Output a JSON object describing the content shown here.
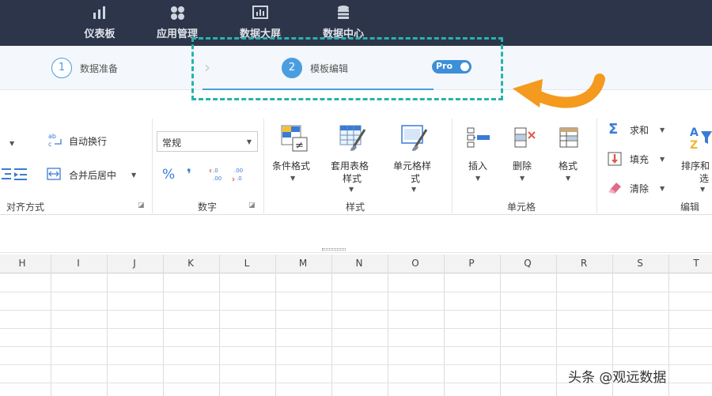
{
  "topnav": {
    "items": [
      {
        "label": "仪表板",
        "icon": "bar-chart-icon"
      },
      {
        "label": "应用管理",
        "icon": "grid-apps-icon"
      },
      {
        "label": "数据大屏",
        "icon": "screen-chart-icon"
      },
      {
        "label": "数据中心",
        "icon": "database-icon"
      }
    ]
  },
  "steps": {
    "step1": {
      "number": "1",
      "label": "数据准备"
    },
    "step2": {
      "number": "2",
      "label": "模板编辑"
    },
    "pro_label": "Pro"
  },
  "ribbon": {
    "alignment": {
      "wrap_text": "自动换行",
      "merge_center": "合并后居中",
      "group_label": "对齐方式"
    },
    "number": {
      "format_value": "常规",
      "percent_symbol": "%",
      "comma_symbol": "❜",
      "group_label": "数字"
    },
    "styles": {
      "conditional_format": "条件格式",
      "table_style_line1": "套用表格",
      "table_style_line2": "样式",
      "cell_style_line1": "单元格样",
      "cell_style_line2": "式",
      "group_label": "样式"
    },
    "cells": {
      "insert": "插入",
      "delete": "删除",
      "format": "格式",
      "group_label": "单元格"
    },
    "editing": {
      "sum": "求和",
      "fill": "填充",
      "clear": "清除",
      "sort_line1": "排序和",
      "sort_line2": "选",
      "group_label": "编辑"
    }
  },
  "grid": {
    "columns": [
      "H",
      "I",
      "J",
      "K",
      "L",
      "M",
      "N",
      "O",
      "P",
      "Q",
      "R",
      "S",
      "T"
    ]
  },
  "watermark": "头条 @观远数据",
  "colors": {
    "nav_bg": "#2c3549",
    "accent_blue": "#4a9ee0",
    "dash_teal": "#27b3ad",
    "arrow_orange": "#f39a1f"
  }
}
